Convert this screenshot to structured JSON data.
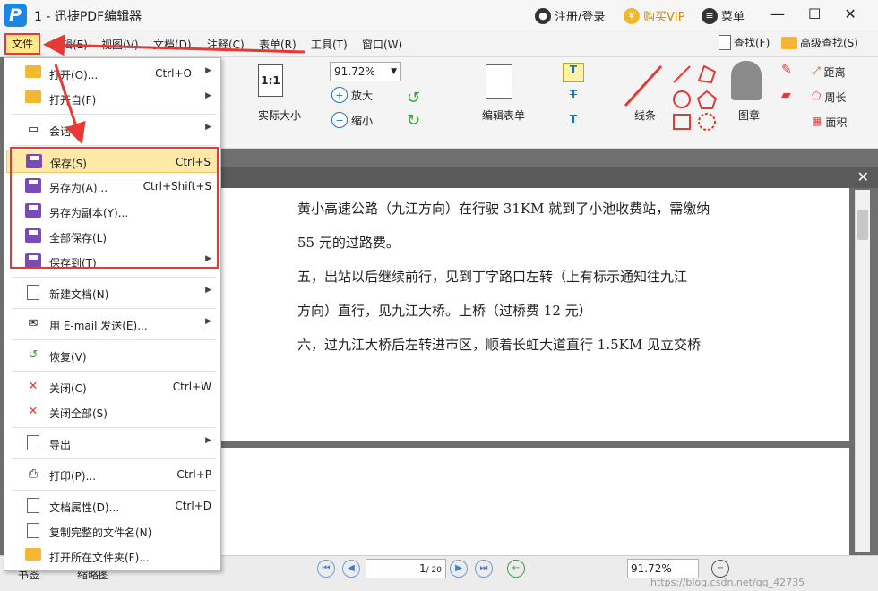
{
  "window": {
    "title": "1 - 迅捷PDF编辑器",
    "logo": "P",
    "login": "注册/登录",
    "vip": "购买VIP",
    "menu": "菜单"
  },
  "menubar": {
    "items": [
      "文件",
      "编辑(E)",
      "视图(V)",
      "文档(D)",
      "注释(C)",
      "表单(R)",
      "工具(T)",
      "窗口(W)"
    ],
    "find": "查找(F)",
    "advanced_find": "高级查找(S)"
  },
  "ribbon": {
    "actual_size": "实际大小",
    "zoom_value": "91.72%",
    "zoom_in": "放大",
    "zoom_out": "缩小",
    "edit_form": "编辑表单",
    "line": "线条",
    "stamp": "图章",
    "distance": "距离",
    "perimeter": "周长",
    "area": "面积"
  },
  "document": {
    "lines": [
      "黄小高速公路（九江方向）在行驶 31KM 就到了小池收费站，需缴纳",
      "55 元的过路费。",
      "五，出站以后继续前行，见到丁字路口左转（上有标示通知往九江",
      "方向）直行，见九江大桥。上桥（过桥费 12 元）",
      "六，过九江大桥后左转进市区，顺着长虹大道直行 1.5KM 见立交桥"
    ]
  },
  "file_menu": {
    "items": [
      {
        "label": "打开(O)...",
        "shortcut": "Ctrl+O",
        "submenu": true
      },
      {
        "label": "打开自(F)",
        "shortcut": "",
        "submenu": true
      },
      {
        "label": "会话",
        "shortcut": "",
        "submenu": true
      },
      {
        "label": "保存(S)",
        "shortcut": "Ctrl+S",
        "submenu": false
      },
      {
        "label": "另存为(A)...",
        "shortcut": "Ctrl+Shift+S",
        "submenu": false
      },
      {
        "label": "另存为副本(Y)...",
        "shortcut": "",
        "submenu": false
      },
      {
        "label": "全部保存(L)",
        "shortcut": "",
        "submenu": false
      },
      {
        "label": "保存到(T)",
        "shortcut": "",
        "submenu": true
      },
      {
        "label": "新建文档(N)",
        "shortcut": "",
        "submenu": true
      },
      {
        "label": "用 E-mail 发送(E)...",
        "shortcut": "",
        "submenu": true
      },
      {
        "label": "恢复(V)",
        "shortcut": "",
        "submenu": false
      },
      {
        "label": "关闭(C)",
        "shortcut": "Ctrl+W",
        "submenu": false
      },
      {
        "label": "关闭全部(S)",
        "shortcut": "",
        "submenu": false
      },
      {
        "label": "导出",
        "shortcut": "",
        "submenu": true
      },
      {
        "label": "打印(P)...",
        "shortcut": "Ctrl+P",
        "submenu": false
      },
      {
        "label": "文档属性(D)...",
        "shortcut": "Ctrl+D",
        "submenu": false
      },
      {
        "label": "复制完整的文件名(N)",
        "shortcut": "",
        "submenu": false
      },
      {
        "label": "打开所在文件夹(F)...",
        "shortcut": "",
        "submenu": false
      }
    ]
  },
  "statusbar": {
    "tab1": "书签",
    "tab2": "缩略图",
    "page_current": "1",
    "page_total": "/ 20",
    "zoom": "91.72%",
    "watermark": "https://blog.csdn.net/qq_42735"
  },
  "colors": {
    "highlight_border": "#e53935",
    "menu_highlight": "#ffe9a6",
    "accent": "#1f86e0"
  }
}
